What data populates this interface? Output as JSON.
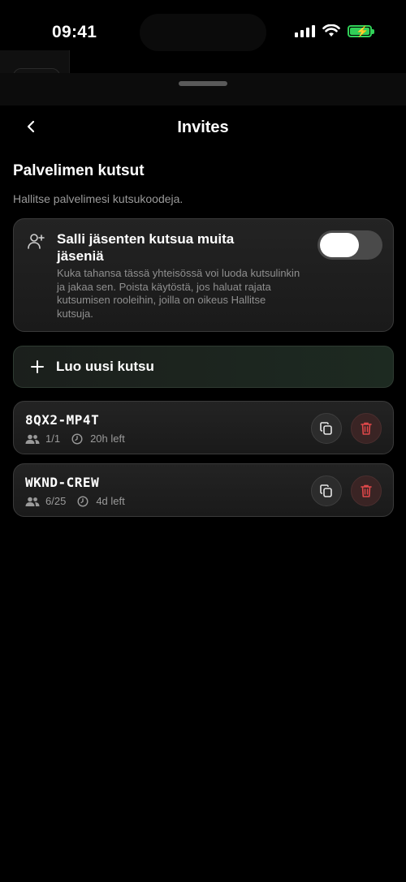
{
  "status_bar": {
    "time": "09:41"
  },
  "nav": {
    "title": "Invites",
    "back_icon": "chevron-left-icon"
  },
  "section": {
    "title": "Palvelimen kutsut",
    "subtitle": "Hallitse palvelimesi kutsukoodeja."
  },
  "permission": {
    "icon": "user-plus-icon",
    "title": "Salli jäsenten kutsua muita jäseniä",
    "description": "Kuka tahansa tässä yhteisössä voi luoda kutsulinkin ja jakaa sen. Poista käytöstä, jos haluat rajata kutsumisen rooleihin, joilla on oikeus Hallitse kutsuja.",
    "toggle_on": true
  },
  "create_button": {
    "label": "Luo uusi kutsu",
    "icon": "plus-icon"
  },
  "invites": [
    {
      "code": "8QX2-MP4T",
      "uses": "1/1",
      "expires": "20h left"
    },
    {
      "code": "WKND-CREW",
      "uses": "6/25",
      "expires": "4d left"
    }
  ],
  "colors": {
    "accent_green": "#31d158",
    "delete_red": "#e0484a",
    "background": "#000000"
  }
}
